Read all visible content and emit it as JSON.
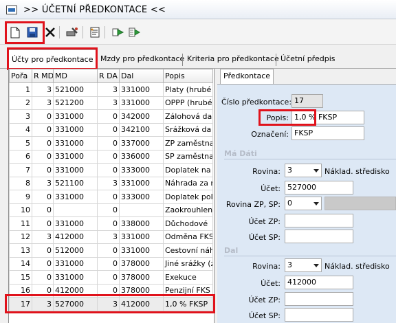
{
  "window": {
    "title": ">>  ÚČETNÍ PŘEDKONTACE  <<"
  },
  "toolbar": {
    "icons": [
      "new-document-icon",
      "save-icon",
      "delete-icon",
      "tools-icon",
      "list-edit-icon",
      "forward-icon",
      "forward-list-icon"
    ]
  },
  "tabs": [
    "Účty pro předkontace",
    "Mzdy pro předkontace",
    "Kriteria pro předkontace",
    "Účetní předpis"
  ],
  "grid": {
    "columns": [
      "Pořa",
      "R MD",
      "MD",
      "R DA",
      "Dal",
      "Popis"
    ],
    "rows": [
      [
        "1",
        "3",
        "521000",
        "3",
        "331000",
        "Platy (hrubé"
      ],
      [
        "2",
        "3",
        "521200",
        "3",
        "331000",
        "OPPP (hrubé"
      ],
      [
        "3",
        "0",
        "331000",
        "0",
        "342000",
        "Zálohová da"
      ],
      [
        "4",
        "0",
        "331000",
        "0",
        "342100",
        "Srážková da"
      ],
      [
        "5",
        "0",
        "331000",
        "0",
        "337000",
        "ZP zaměstna"
      ],
      [
        "6",
        "0",
        "331000",
        "0",
        "336000",
        "SP zaměstna"
      ],
      [
        "7",
        "0",
        "331000",
        "0",
        "333000",
        "Doplatek na"
      ],
      [
        "8",
        "3",
        "521100",
        "3",
        "331000",
        "Náhrada za r"
      ],
      [
        "9",
        "0",
        "331000",
        "0",
        "333000",
        "Doplatek pol"
      ],
      [
        "10",
        "0",
        "",
        "0",
        "",
        "Zaokrouhlen"
      ],
      [
        "11",
        "0",
        "331000",
        "0",
        "338000",
        "Důchodové"
      ],
      [
        "12",
        "3",
        "412000",
        "3",
        "331000",
        "Odměna FKS"
      ],
      [
        "13",
        "0",
        "512000",
        "0",
        "331000",
        "Cestovní náh"
      ],
      [
        "14",
        "0",
        "331000",
        "0",
        "378000",
        "Jiné srážky (z"
      ],
      [
        "15",
        "0",
        "331000",
        "0",
        "378000",
        "Exekuce"
      ],
      [
        "16",
        "0",
        "412000",
        "0",
        "378000",
        "Penzijní FKS"
      ],
      [
        "17",
        "3",
        "527000",
        "3",
        "412000",
        "1,0 % FKSP"
      ]
    ]
  },
  "detail": {
    "tab": "Předkontace",
    "cislo_label": "Číslo předkontace:",
    "cislo_value": "17",
    "popis_label": "Popis:",
    "popis_value": "1,0 % FKSP",
    "oznaceni_label": "Označení:",
    "oznaceni_value": "FKSP",
    "ma_dati": {
      "title": "Má Dáti",
      "rovina_label": "Rovina:",
      "rovina_value": "3",
      "rovina_text": "Náklad. středisko",
      "ucet_label": "Účet:",
      "ucet_value": "527000",
      "rovina_zp_sp_label": "Rovina ZP, SP:",
      "rovina_zp_sp_value": "0",
      "ucet_zp_label": "Účet ZP:",
      "ucet_zp_value": "",
      "ucet_sp_label": "Účet SP:",
      "ucet_sp_value": ""
    },
    "dal": {
      "title": "Dal",
      "rovina_label": "Rovina:",
      "rovina_value": "3",
      "rovina_text": "Náklad. středisko",
      "ucet_label": "Účet:",
      "ucet_value": "412000",
      "ucet_zp_label": "Účet ZP:",
      "ucet_zp_value": "",
      "ucet_sp_label": "Účet SP:",
      "ucet_sp_value": ""
    }
  },
  "colors": {
    "highlight": "#e0121b",
    "form_background": "#dde8f5",
    "section_title": "#b5bcc8"
  }
}
